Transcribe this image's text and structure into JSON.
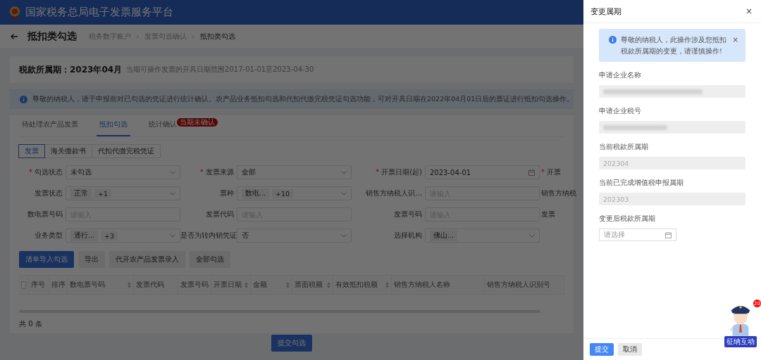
{
  "header": {
    "title": "国家税务总局电子发票服务平台"
  },
  "page": {
    "title": "抵扣类勾选",
    "breadcrumb": [
      {
        "label": "税务数字账户",
        "current": false
      },
      {
        "label": "发票勾选确认",
        "current": false
      },
      {
        "label": "抵扣类勾选",
        "current": true
      }
    ]
  },
  "period": {
    "label": "税款所属期：2023年04月",
    "note": "当期可操作发票的开具日期范围2017-01-01至2023-04-30"
  },
  "notice": "尊敬的纳税人，请于申报前对已勾选的凭证进行统计确认。农产品业务抵扣勾选和代扣代缴完税凭证勾选功能，可对开具日期在2022年04月01日后的票证进行抵扣勾选操作。",
  "tabs": [
    {
      "label": "待处理农产品发票",
      "selected": false
    },
    {
      "label": "抵扣勾选",
      "selected": true
    },
    {
      "label": "统计确认",
      "selected": false,
      "badge": "当期未确认"
    }
  ],
  "doc_types": [
    {
      "label": "发票",
      "selected": true
    },
    {
      "label": "海关缴款书",
      "selected": false
    },
    {
      "label": "代扣代缴完税凭证",
      "selected": false
    }
  ],
  "required_mark": "*",
  "filters": [
    {
      "label": "勾选状态",
      "required": true,
      "kind": "select",
      "value": "未勾选"
    },
    {
      "label": "发票来源",
      "required": true,
      "kind": "select",
      "value": "全部"
    },
    {
      "label": "开票日期(起)",
      "required": true,
      "kind": "date",
      "value": "2023-04-01"
    },
    {
      "label": "开票",
      "required": true,
      "kind": "cut"
    },
    {
      "label": "发票状态",
      "required": false,
      "kind": "tags",
      "tags": [
        "正常",
        "+1"
      ]
    },
    {
      "label": "票种",
      "required": false,
      "kind": "tags",
      "tags": [
        "数电...",
        "+10"
      ]
    },
    {
      "label": "销售方纳税人识...",
      "required": false,
      "kind": "input",
      "placeholder": "请输入"
    },
    {
      "label": "销售方纳税",
      "required": false,
      "kind": "cut"
    },
    {
      "label": "数电票号码",
      "required": false,
      "kind": "input",
      "placeholder": "请输入"
    },
    {
      "label": "发票代码",
      "required": false,
      "kind": "input",
      "placeholder": "请输入"
    },
    {
      "label": "发票号码",
      "required": false,
      "kind": "input",
      "placeholder": "请输入"
    },
    {
      "label": "发票",
      "required": false,
      "kind": "cut"
    },
    {
      "label": "业务类型",
      "required": false,
      "kind": "tags",
      "tags": [
        "通行...",
        "+3"
      ]
    },
    {
      "label": "是否为转内销凭证",
      "required": false,
      "kind": "select",
      "value": "否"
    },
    {
      "label": "选择机构",
      "required": false,
      "kind": "tags",
      "tags": [
        "佛山..."
      ]
    }
  ],
  "actions": [
    {
      "label": "清单导入勾选",
      "primary": true
    },
    {
      "label": "导出",
      "primary": false
    },
    {
      "label": "代开农产品发票录入",
      "primary": false
    },
    {
      "label": "全部勾选",
      "primary": false
    }
  ],
  "table": {
    "select_all": {
      "checked": false
    },
    "columns": [
      {
        "label": "序号",
        "sortable": false
      },
      {
        "label": "排序",
        "sortable": false
      },
      {
        "label": "数电票号码",
        "sortable": true
      },
      {
        "label": "发票代码",
        "sortable": false
      },
      {
        "label": "发票号码",
        "sortable": false
      },
      {
        "label": "开票日期",
        "sortable": true
      },
      {
        "label": "金额",
        "sortable": true
      },
      {
        "label": "票面税额",
        "sortable": true
      },
      {
        "label": "有效抵扣税额",
        "sortable": true
      },
      {
        "label": "销售方纳税人名称",
        "sortable": false
      },
      {
        "label": "销售方纳税人识别号",
        "sortable": false
      }
    ]
  },
  "total": "共 0 条",
  "submit": "提交勾选",
  "drawer": {
    "title": "变更属期",
    "close": "×",
    "alert": {
      "text": "尊敬的纳税人，此操作涉及您抵扣税款所属期的变更，请谨慎操作!",
      "close": "×"
    },
    "fields": [
      {
        "label": "申请企业名称",
        "kind": "redacted"
      },
      {
        "label": "申请企业税号",
        "kind": "redacted"
      },
      {
        "label": "当前税款所属期",
        "kind": "readonly",
        "value": "202304"
      },
      {
        "label": "当前已完成增值税申报属期",
        "kind": "readonly",
        "value": "202303"
      },
      {
        "label": "变更后税款所属期",
        "kind": "date",
        "placeholder": "请选择"
      }
    ],
    "buttons": [
      {
        "label": "提交",
        "primary": true
      },
      {
        "label": "取消",
        "primary": false
      }
    ]
  },
  "assistant": {
    "badge": "20",
    "caption": "征纳互动"
  }
}
